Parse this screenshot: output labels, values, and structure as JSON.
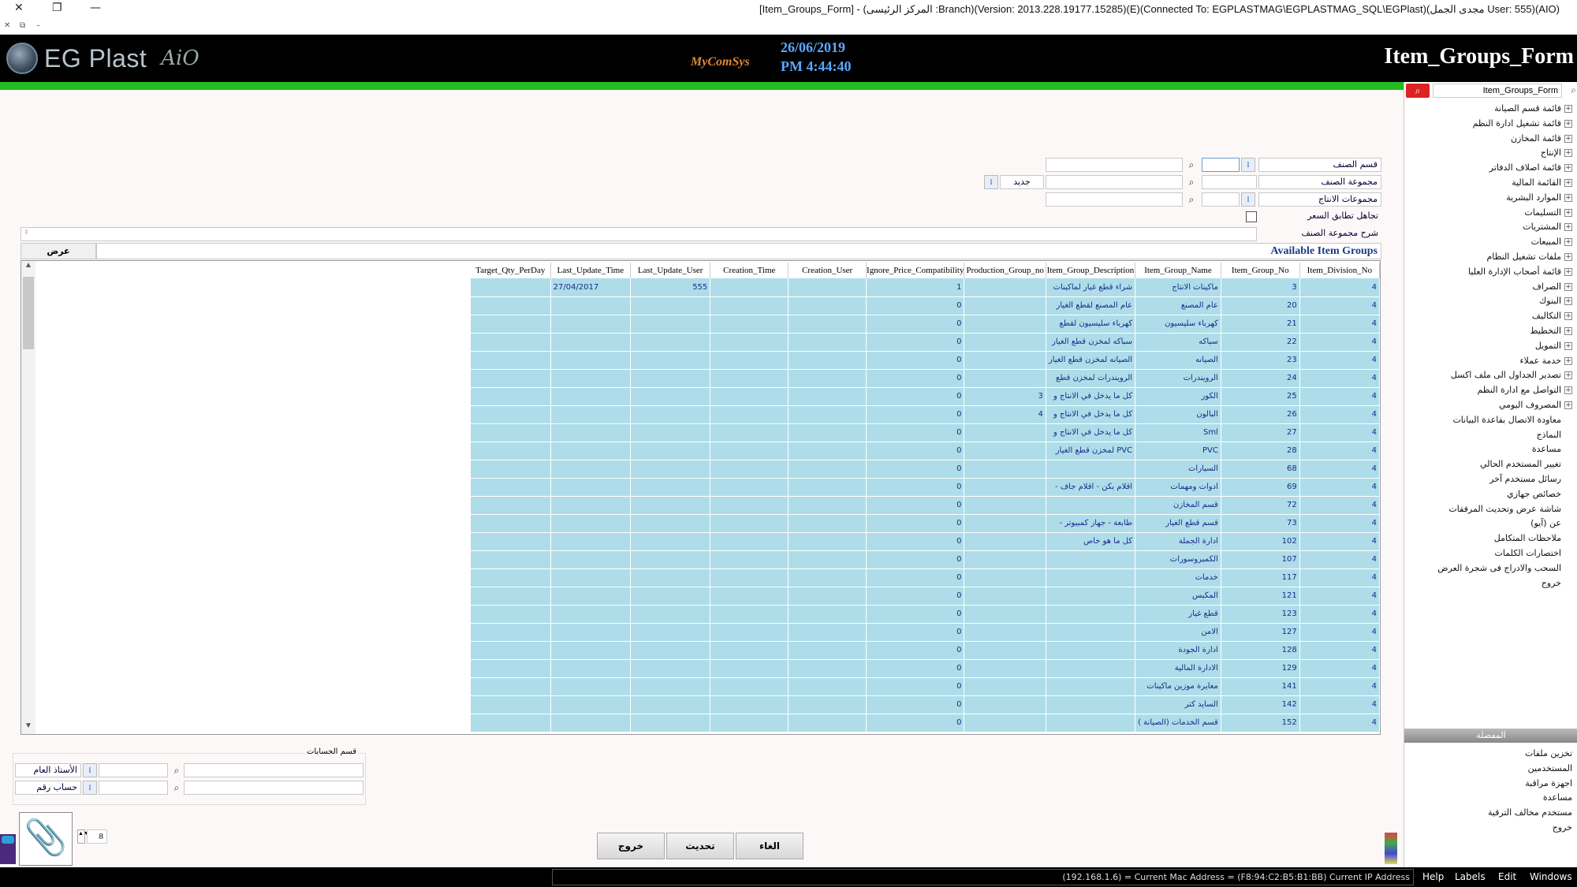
{
  "window": {
    "title": "[Item_Groups_Form] - (المركز الرئيسى :Branch)(Version: 2013.228.19177.15285)(E)(Connected To: EGPLASTMAG\\EGPLASTMAG_SQL\\EGPlast)(مجدى الجمل User: 555)(AIO)",
    "close_glyph": "✕",
    "restore_glyph": "❐",
    "minimize_glyph": "—",
    "sub_close": "✕",
    "sub_restore": "⧉",
    "sub_min": "–"
  },
  "header": {
    "logo_text": "EG Plast",
    "logo_suffix": "AiO",
    "brand": "MyComSys",
    "date": "26/06/2019",
    "time": "PM 4:44:40",
    "form_title": "Item_Groups_Form"
  },
  "filters": {
    "division_label": "قسم الصنف",
    "group_label": "مجموعة الصنف",
    "production_label": "مجموعات الانتاج",
    "ignore_price_label": "تجاهل تطابق السعر",
    "description_label": "شرح مجموعة الصنف",
    "new_button": "جديد",
    "mini_btn": "I"
  },
  "grid_header": {
    "title": "Available Item Groups",
    "view_button": "عرض"
  },
  "columns": [
    "Target_Qty_PerDay",
    "Last_Update_Time",
    "Last_Update_User",
    "Creation_Time",
    "Creation_User",
    "Ignore_Price_Compatibility",
    "Production_Group_no",
    "Item_Group_Description",
    "Item_Group_Name",
    "Item_Group_No",
    "Item_Division_No"
  ],
  "rows": [
    {
      "target": "",
      "upd_time": "27/04/2017",
      "upd_user": "555",
      "cr_time": "",
      "cr_user": "",
      "ignore": "1",
      "prod": "",
      "desc": "شراء قطع غيار لماكينات",
      "name": "ماكينات الانتاج",
      "no": "3",
      "div": "4"
    },
    {
      "target": "",
      "upd_time": "",
      "upd_user": "",
      "cr_time": "",
      "cr_user": "",
      "ignore": "0",
      "prod": "",
      "desc": "عام المصنع لقطع الغيار",
      "name": "عام المصنع",
      "no": "20",
      "div": "4"
    },
    {
      "target": "",
      "upd_time": "",
      "upd_user": "",
      "cr_time": "",
      "cr_user": "",
      "ignore": "0",
      "prod": "",
      "desc": "كهرباء سليسيون لقطع",
      "name": "كهرباء سليسيون",
      "no": "21",
      "div": "4"
    },
    {
      "target": "",
      "upd_time": "",
      "upd_user": "",
      "cr_time": "",
      "cr_user": "",
      "ignore": "0",
      "prod": "",
      "desc": "سباكه لمخزن قطع الغيار",
      "name": "سباكه",
      "no": "22",
      "div": "4"
    },
    {
      "target": "",
      "upd_time": "",
      "upd_user": "",
      "cr_time": "",
      "cr_user": "",
      "ignore": "0",
      "prod": "",
      "desc": "الصيانه لمخزن قطع الغيار",
      "name": "الصيانه",
      "no": "23",
      "div": "4"
    },
    {
      "target": "",
      "upd_time": "",
      "upd_user": "",
      "cr_time": "",
      "cr_user": "",
      "ignore": "0",
      "prod": "",
      "desc": "الرويندرات لمخزن قطع",
      "name": "الرويندرات",
      "no": "24",
      "div": "4"
    },
    {
      "target": "",
      "upd_time": "",
      "upd_user": "",
      "cr_time": "",
      "cr_user": "",
      "ignore": "0",
      "prod": "3",
      "desc": "كل ما يدخل في الانتاج و",
      "name": "الكور",
      "no": "25",
      "div": "4"
    },
    {
      "target": "",
      "upd_time": "",
      "upd_user": "",
      "cr_time": "",
      "cr_user": "",
      "ignore": "0",
      "prod": "4",
      "desc": "كل ما يدخل في الانتاج و",
      "name": "البالون",
      "no": "26",
      "div": "4"
    },
    {
      "target": "",
      "upd_time": "",
      "upd_user": "",
      "cr_time": "",
      "cr_user": "",
      "ignore": "0",
      "prod": "",
      "desc": "كل ما يدخل في الانتاج و",
      "name": "Sml",
      "no": "27",
      "div": "4"
    },
    {
      "target": "",
      "upd_time": "",
      "upd_user": "",
      "cr_time": "",
      "cr_user": "",
      "ignore": "0",
      "prod": "",
      "desc": "PVC لمخزن قطع الغيار",
      "name": "PVC",
      "no": "28",
      "div": "4"
    },
    {
      "target": "",
      "upd_time": "",
      "upd_user": "",
      "cr_time": "",
      "cr_user": "",
      "ignore": "0",
      "prod": "",
      "desc": "",
      "name": "السيارات",
      "no": "68",
      "div": "4"
    },
    {
      "target": "",
      "upd_time": "",
      "upd_user": "",
      "cr_time": "",
      "cr_user": "",
      "ignore": "0",
      "prod": "",
      "desc": "اقلام بكن - اقلام جاف -",
      "name": "ادوات ومهمات",
      "no": "69",
      "div": "4"
    },
    {
      "target": "",
      "upd_time": "",
      "upd_user": "",
      "cr_time": "",
      "cr_user": "",
      "ignore": "0",
      "prod": "",
      "desc": "",
      "name": "قسم المخازن",
      "no": "72",
      "div": "4"
    },
    {
      "target": "",
      "upd_time": "",
      "upd_user": "",
      "cr_time": "",
      "cr_user": "",
      "ignore": "0",
      "prod": "",
      "desc": "طابعة - جهاز كمبيوتر -",
      "name": "قسم قطع الغيار",
      "no": "73",
      "div": "4"
    },
    {
      "target": "",
      "upd_time": "",
      "upd_user": "",
      "cr_time": "",
      "cr_user": "",
      "ignore": "0",
      "prod": "",
      "desc": "كل ما هو خاص",
      "name": "ادارة الجملة",
      "no": "102",
      "div": "4"
    },
    {
      "target": "",
      "upd_time": "",
      "upd_user": "",
      "cr_time": "",
      "cr_user": "",
      "ignore": "0",
      "prod": "",
      "desc": "",
      "name": "الكمبروسورات",
      "no": "107",
      "div": "4"
    },
    {
      "target": "",
      "upd_time": "",
      "upd_user": "",
      "cr_time": "",
      "cr_user": "",
      "ignore": "0",
      "prod": "",
      "desc": "",
      "name": "خدمات",
      "no": "117",
      "div": "4"
    },
    {
      "target": "",
      "upd_time": "",
      "upd_user": "",
      "cr_time": "",
      "cr_user": "",
      "ignore": "0",
      "prod": "",
      "desc": "",
      "name": "المكبس",
      "no": "121",
      "div": "4"
    },
    {
      "target": "",
      "upd_time": "",
      "upd_user": "",
      "cr_time": "",
      "cr_user": "",
      "ignore": "0",
      "prod": "",
      "desc": "",
      "name": "قطع غيار",
      "no": "123",
      "div": "4"
    },
    {
      "target": "",
      "upd_time": "",
      "upd_user": "",
      "cr_time": "",
      "cr_user": "",
      "ignore": "0",
      "prod": "",
      "desc": "",
      "name": "الامن",
      "no": "127",
      "div": "4"
    },
    {
      "target": "",
      "upd_time": "",
      "upd_user": "",
      "cr_time": "",
      "cr_user": "",
      "ignore": "0",
      "prod": "",
      "desc": "",
      "name": "ادارة الجودة",
      "no": "128",
      "div": "4"
    },
    {
      "target": "",
      "upd_time": "",
      "upd_user": "",
      "cr_time": "",
      "cr_user": "",
      "ignore": "0",
      "prod": "",
      "desc": "",
      "name": "الادارة المالية",
      "no": "129",
      "div": "4"
    },
    {
      "target": "",
      "upd_time": "",
      "upd_user": "",
      "cr_time": "",
      "cr_user": "",
      "ignore": "0",
      "prod": "",
      "desc": "",
      "name": "معايرة موزين ماكينات",
      "no": "141",
      "div": "4"
    },
    {
      "target": "",
      "upd_time": "",
      "upd_user": "",
      "cr_time": "",
      "cr_user": "",
      "ignore": "0",
      "prod": "",
      "desc": "",
      "name": "السايد كتر",
      "no": "142",
      "div": "4"
    },
    {
      "target": "",
      "upd_time": "",
      "upd_user": "",
      "cr_time": "",
      "cr_user": "",
      "ignore": "0",
      "prod": "",
      "desc": "",
      "name": "قسم الخدمات (الصيانة )",
      "no": "152",
      "div": "4"
    }
  ],
  "accounts": {
    "caption": "قسم الحسابات",
    "ledger_label": "الأستاذ العام",
    "account_label": "حساب رقم"
  },
  "bottom": {
    "attach_count": "8",
    "cancel": "الغاء",
    "update": "تحديث",
    "exit": "خروج"
  },
  "tree": {
    "search_value": "Item_Groups_Form",
    "items": [
      {
        "label": "قائمة قسم الصيانة",
        "plus": true
      },
      {
        "label": "قائمة تشغيل ادارة النظم",
        "plus": true
      },
      {
        "label": "قائمة المخازن",
        "plus": true
      },
      {
        "label": "الإنتاج",
        "plus": true
      },
      {
        "label": "قائمة اصلاف الدفاتر",
        "plus": true
      },
      {
        "label": "القائمة المالية",
        "plus": true
      },
      {
        "label": "الموارد البشرية",
        "plus": true
      },
      {
        "label": "التسليمات",
        "plus": true
      },
      {
        "label": "المشتريات",
        "plus": true
      },
      {
        "label": "المبيعات",
        "plus": true
      },
      {
        "label": "ملفات تشغيل النظام",
        "plus": true
      },
      {
        "label": "قائمة أصحاب الإدارة العليا",
        "plus": true
      },
      {
        "label": "الصراف",
        "plus": true
      },
      {
        "label": "البنوك",
        "plus": true
      },
      {
        "label": "التكاليف",
        "plus": true
      },
      {
        "label": "التخطيط",
        "plus": true
      },
      {
        "label": "التمويل",
        "plus": true
      },
      {
        "label": "خدمة عملاء",
        "plus": true
      },
      {
        "label": "تصدير الجداول الى ملف اكسل",
        "plus": true
      },
      {
        "label": "التواصل مع ادارة النظم",
        "plus": true
      },
      {
        "label": "المصروف اليومي",
        "plus": true
      },
      {
        "label": "معاودة الاتصال بقاعدة البيانات",
        "plus": false
      },
      {
        "label": "النماذج",
        "plus": false
      },
      {
        "label": "مساعدة",
        "plus": false
      },
      {
        "label": "تغيير المستخدم الحالي",
        "plus": false
      },
      {
        "label": "رسائل مستخدم آخر",
        "plus": false
      },
      {
        "label": "خصائص جهازي",
        "plus": false
      },
      {
        "label": "شاشة عرض وتحديث المرفقات",
        "plus": false
      },
      {
        "label": "عن (آيو)",
        "plus": false
      },
      {
        "label": "ملاحظات المتكامل",
        "plus": false
      },
      {
        "label": "اختصارات الكلمات",
        "plus": false
      },
      {
        "label": "السحب والادراج فى شجرة العرض",
        "plus": false
      },
      {
        "label": "خروج",
        "plus": false
      }
    ],
    "favorites_title": "المفضلة",
    "favorites": [
      {
        "label": "تخزين ملفات"
      },
      {
        "label": "المستخدمين"
      },
      {
        "label": "اجهزة مراقبة"
      },
      {
        "label": "مساعدة"
      },
      {
        "label": "مستخدم مخالف الترقية"
      },
      {
        "label": "خروج"
      }
    ]
  },
  "status": {
    "text": "(192.168.1.6) = Current Mac Address = (F8:94:C2:B5:B1:BB) Current IP Address",
    "menus": [
      "Help",
      "Labels",
      "Edit",
      "Windows"
    ]
  },
  "colors": {
    "header_bg": "#000000",
    "accent_green": "#22bb22",
    "grid_row": "#aedde9",
    "date_blue": "#5aa8ff",
    "search_red": "#dd2222"
  }
}
